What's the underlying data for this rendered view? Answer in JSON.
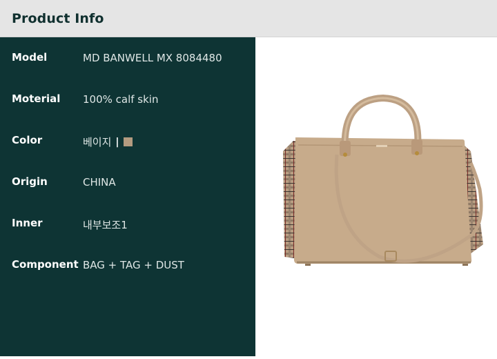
{
  "header": {
    "title": "Product Info"
  },
  "specs": [
    {
      "label": "Model",
      "value": "MD BANWELL MX 8084480"
    },
    {
      "label": "Moterial",
      "value": "100% calf skin"
    },
    {
      "label": "Color",
      "value": "베이지",
      "separator": "|",
      "swatch_color": "#b39b80"
    },
    {
      "label": "Origin",
      "value": "CHINA"
    },
    {
      "label": "Inner",
      "value": "내부보조1"
    },
    {
      "label": "Component",
      "value": "BAG + TAG + DUST"
    }
  ],
  "product_image": {
    "icon": "beige-leather-tote-bag",
    "bag_color": "#c7ab8b"
  }
}
